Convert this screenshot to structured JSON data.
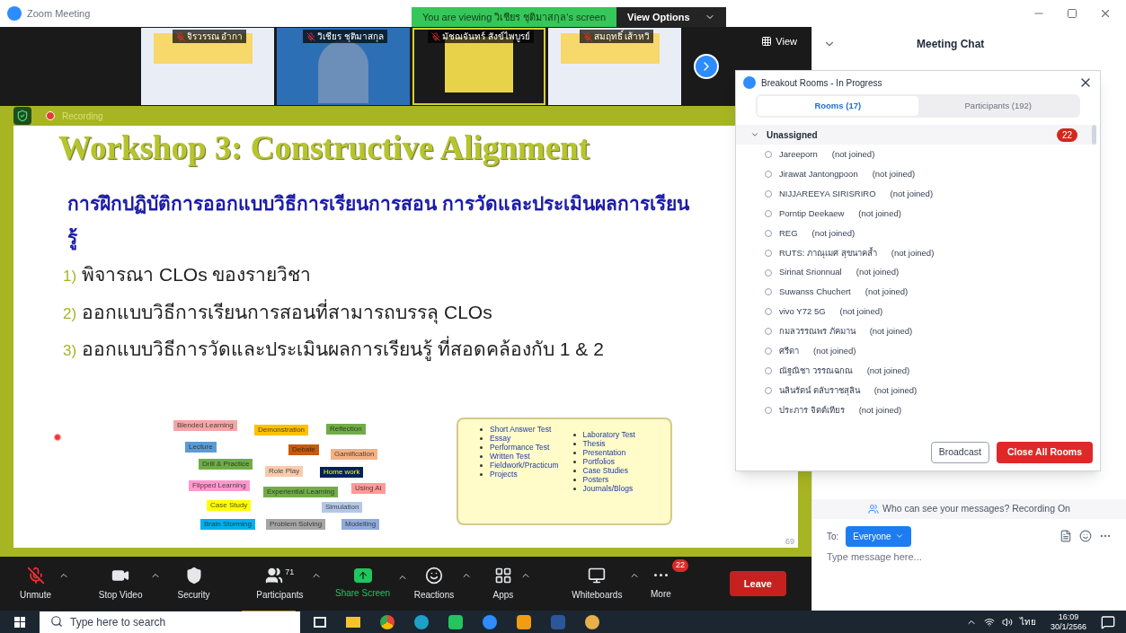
{
  "window": {
    "title": "Zoom Meeting",
    "banner": "You are viewing วิเชียร ชุติมาสกุล's screen",
    "view_options": "View Options"
  },
  "thumbnails": [
    {
      "name": "จิรวรรณ อำกา",
      "kind": "slide",
      "active": false
    },
    {
      "name": "วิเชียร ชุติมาสกุล",
      "kind": "camera",
      "active": false
    },
    {
      "name": "มัชฌจันทร์ สังข์ไพบูรย์",
      "kind": "portrait",
      "active": true
    },
    {
      "name": "สมฤทธิ์ เส้าหวิ",
      "kind": "slide",
      "active": false
    }
  ],
  "view_button": "View",
  "recording": "Recording",
  "slide": {
    "title": "Workshop 3: Constructive Alignment",
    "heading": "การฝึกปฏิบัติการออกแบบวิธีการเรียนการสอน การวัดและประเมินผลการเรียนรู้",
    "items": [
      {
        "number": "1)",
        "text": "พิจารณา CLOs ของรายวิชา"
      },
      {
        "number": "2)",
        "text": "ออกแบบวิธีการเรียนการสอนที่สามารถบรรลุ CLOs"
      },
      {
        "number": "3)",
        "text": "ออกแบบวิธีการวัดและประเมินผลการเรียนรู้ ที่สอดคล้องกับ 1 & 2"
      }
    ],
    "tags": [
      {
        "text": "Blended Learning",
        "color": "#f4a6a6"
      },
      {
        "text": "Demonstration",
        "color": "#ffc000"
      },
      {
        "text": "Reflection",
        "color": "#70ad47"
      },
      {
        "text": "Lecture",
        "color": "#5b9bd5"
      },
      {
        "text": "Debate",
        "color": "#c55a11"
      },
      {
        "text": "Gamification",
        "color": "#f4b183"
      },
      {
        "text": "Drill & Practice",
        "color": "#70ad47"
      },
      {
        "text": "Role Play",
        "color": "#f8cbad"
      },
      {
        "text": "Home work",
        "color": "#002060"
      },
      {
        "text": "Flipped Learning",
        "color": "#ff99cc"
      },
      {
        "text": "Experiential Learning",
        "color": "#70ad47"
      },
      {
        "text": "Using AI",
        "color": "#ff9999"
      },
      {
        "text": "Case Study",
        "color": "#ffff00"
      },
      {
        "text": "Simulation",
        "color": "#b4c7e7"
      },
      {
        "text": "Brain Storming",
        "color": "#00b0f0"
      },
      {
        "text": "Problem Solving",
        "color": "#a5a5a5"
      },
      {
        "text": "Modelling",
        "color": "#8faadc"
      }
    ],
    "assessment_left": [
      "Short Answer Test",
      "Essay",
      "Performance Test",
      "Written Test",
      "Fieldwork/Practicum",
      "Projects"
    ],
    "assessment_right": [
      "Laboratory Test",
      "Thesis",
      "Presentation",
      "Portfolios",
      "Case Studies",
      "Posters",
      "Journals/Blogs"
    ],
    "page": "69"
  },
  "toolbar": [
    {
      "kind": "mic-muted",
      "label": "Unmute",
      "caret": true
    },
    {
      "kind": "video",
      "label": "Stop Video",
      "caret": true
    },
    {
      "kind": "security",
      "label": "Security",
      "caret": false
    },
    {
      "kind": "participants",
      "label": "Participants",
      "count": "71",
      "caret": true
    },
    {
      "kind": "share",
      "label": "Share Screen",
      "caret": true
    },
    {
      "kind": "reactions",
      "label": "Reactions",
      "caret": true
    },
    {
      "kind": "apps",
      "label": "Apps",
      "caret": true
    },
    {
      "kind": "whiteboard",
      "label": "Whiteboards",
      "caret": true
    },
    {
      "kind": "more",
      "label": "More",
      "badge": "22",
      "caret": false
    }
  ],
  "leave": "Leave",
  "chat": {
    "title": "Meeting Chat",
    "notice": "Who can see your messages? Recording On",
    "to_label": "To:",
    "to_value": "Everyone",
    "placeholder": "Type message here..."
  },
  "breakout": {
    "title": "Breakout Rooms - In Progress",
    "tabs": [
      {
        "label": "Rooms (17)",
        "selected": true
      },
      {
        "label": "Participants (192)",
        "selected": false
      }
    ],
    "group": {
      "name": "Unassigned",
      "count": "22",
      "expanded": true
    },
    "people": [
      {
        "name": "Jareeporn",
        "status": "(not joined)",
        "selected": false
      },
      {
        "name": "Jirawat Jantongpoon",
        "status": "(not joined)",
        "selected": false
      },
      {
        "name": "NIJJAREEYA SIRISRIRO",
        "status": "(not joined)",
        "selected": false
      },
      {
        "name": "Porntip Deekaew",
        "status": "(not joined)",
        "selected": false
      },
      {
        "name": "REG",
        "status": "(not joined)",
        "selected": false
      },
      {
        "name": "RUTS: ภาณุเมศ สุขนาคล้ำ",
        "status": "(not joined)",
        "selected": false
      },
      {
        "name": "Sirinat Srionnual",
        "status": "(not joined)",
        "selected": false
      },
      {
        "name": "Suwanss Chuchert",
        "status": "(not joined)",
        "selected": false
      },
      {
        "name": "vivo Y72 5G",
        "status": "(not joined)",
        "selected": false
      },
      {
        "name": "กมลวรรณพร ภัคมาน",
        "status": "(not joined)",
        "selected": false
      },
      {
        "name": "ศรีดา",
        "status": "(not joined)",
        "selected": false
      },
      {
        "name": "ณัฐณิชา วรรณฉกณ",
        "status": "(not joined)",
        "selected": false
      },
      {
        "name": "นลินรัตน์ ตลับราชสุลิน",
        "status": "(not joined)",
        "selected": false
      },
      {
        "name": "ประภาร จิตต์เทียร",
        "status": "(not joined)",
        "selected": false
      }
    ],
    "buttons": [
      {
        "label": "Broadcast",
        "kind": "secondary"
      },
      {
        "label": "Close All Rooms",
        "kind": "primary"
      }
    ]
  },
  "taskbar": {
    "search_placeholder": "Type here to search",
    "language": "ไทย",
    "time": "16:09",
    "date": "30/1/2566"
  }
}
